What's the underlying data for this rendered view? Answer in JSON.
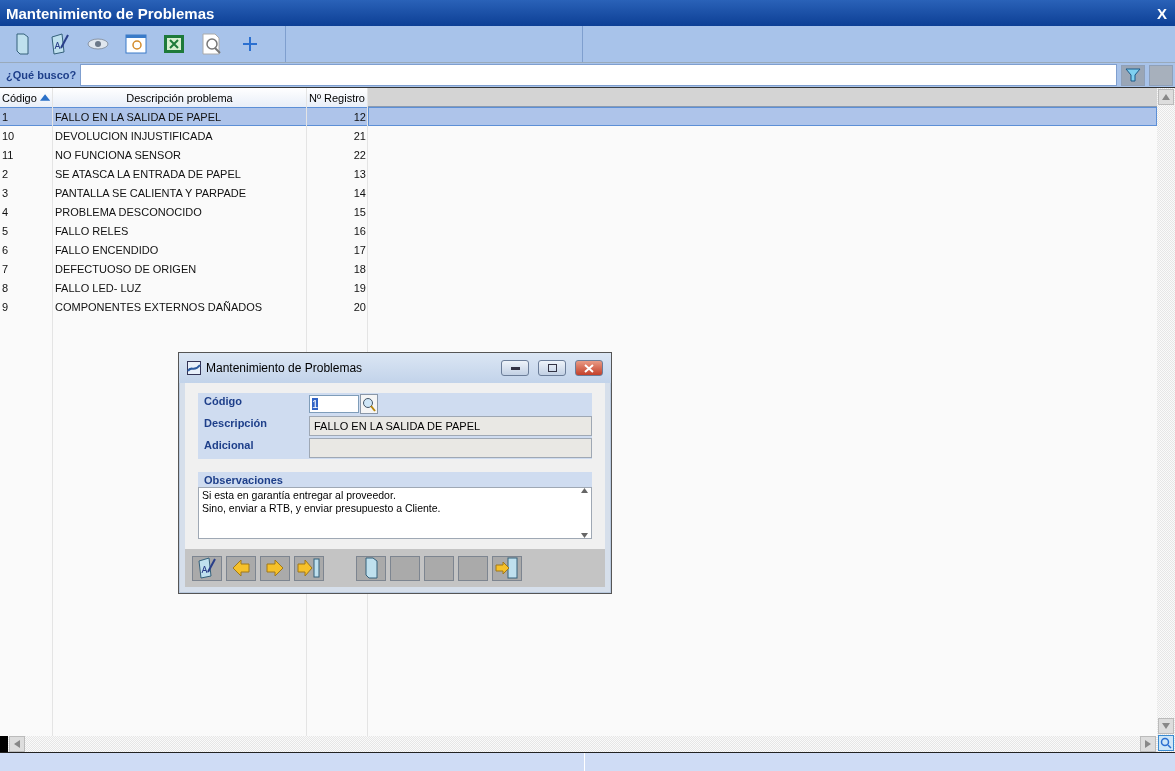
{
  "window": {
    "title": "Mantenimiento de Problemas",
    "close": "X"
  },
  "toolbar": [
    {
      "kind": "new"
    },
    {
      "kind": "edit"
    },
    {
      "kind": "view"
    },
    {
      "kind": "preview"
    },
    {
      "kind": "excel"
    },
    {
      "kind": "search"
    },
    {
      "kind": "add"
    }
  ],
  "search": {
    "label": "¿Qué busco?"
  },
  "table": {
    "columns": [
      {
        "label": "Código",
        "sorted": true
      },
      {
        "label": "Descripción problema",
        "sorted": false
      },
      {
        "label": "Nº Registro",
        "sorted": false
      }
    ],
    "rows": [
      {
        "cells": [
          "1",
          "FALLO EN LA SALIDA DE PAPEL",
          "12"
        ],
        "selected": true
      },
      {
        "cells": [
          "10",
          "DEVOLUCION INJUSTIFICADA",
          "21"
        ],
        "selected": false
      },
      {
        "cells": [
          "11",
          "NO FUNCIONA SENSOR",
          "22"
        ],
        "selected": false
      },
      {
        "cells": [
          "2",
          "SE ATASCA LA ENTRADA DE PAPEL",
          "13"
        ],
        "selected": false
      },
      {
        "cells": [
          "3",
          "PANTALLA SE CALIENTA Y PARPADE",
          "14"
        ],
        "selected": false
      },
      {
        "cells": [
          "4",
          "PROBLEMA DESCONOCIDO",
          "15"
        ],
        "selected": false
      },
      {
        "cells": [
          "5",
          "FALLO RELES",
          "16"
        ],
        "selected": false
      },
      {
        "cells": [
          "6",
          "FALLO ENCENDIDO",
          "17"
        ],
        "selected": false
      },
      {
        "cells": [
          "7",
          "DEFECTUOSO DE ORIGEN",
          "18"
        ],
        "selected": false
      },
      {
        "cells": [
          "8",
          "FALLO LED- LUZ",
          "19"
        ],
        "selected": false
      },
      {
        "cells": [
          "9",
          "COMPONENTES EXTERNOS DAÑADOS",
          "20"
        ],
        "selected": false
      }
    ]
  },
  "dialog": {
    "title": "Mantenimiento de Problemas",
    "fields": [
      {
        "label": "Código",
        "value": "1",
        "kind": "code",
        "text_selected": true
      },
      {
        "label": "Descripción",
        "value": "FALLO EN LA SALIDA DE PAPEL",
        "kind": "text"
      },
      {
        "label": "Adicional",
        "kind": "text"
      }
    ],
    "notes": {
      "label": "Observaciones",
      "lines": [
        "Si esta en garantía entregar al proveedor.",
        "Sino, enviar a RTB, y enviar presupuesto a Cliente."
      ]
    },
    "buttons": [
      {
        "kind": "edit"
      },
      {
        "kind": "prev"
      },
      {
        "kind": "next"
      },
      {
        "kind": "last"
      },
      {
        "kind": "new"
      },
      {
        "kind": "empty"
      },
      {
        "kind": "empty"
      },
      {
        "kind": "empty"
      },
      {
        "kind": "exit"
      }
    ]
  }
}
